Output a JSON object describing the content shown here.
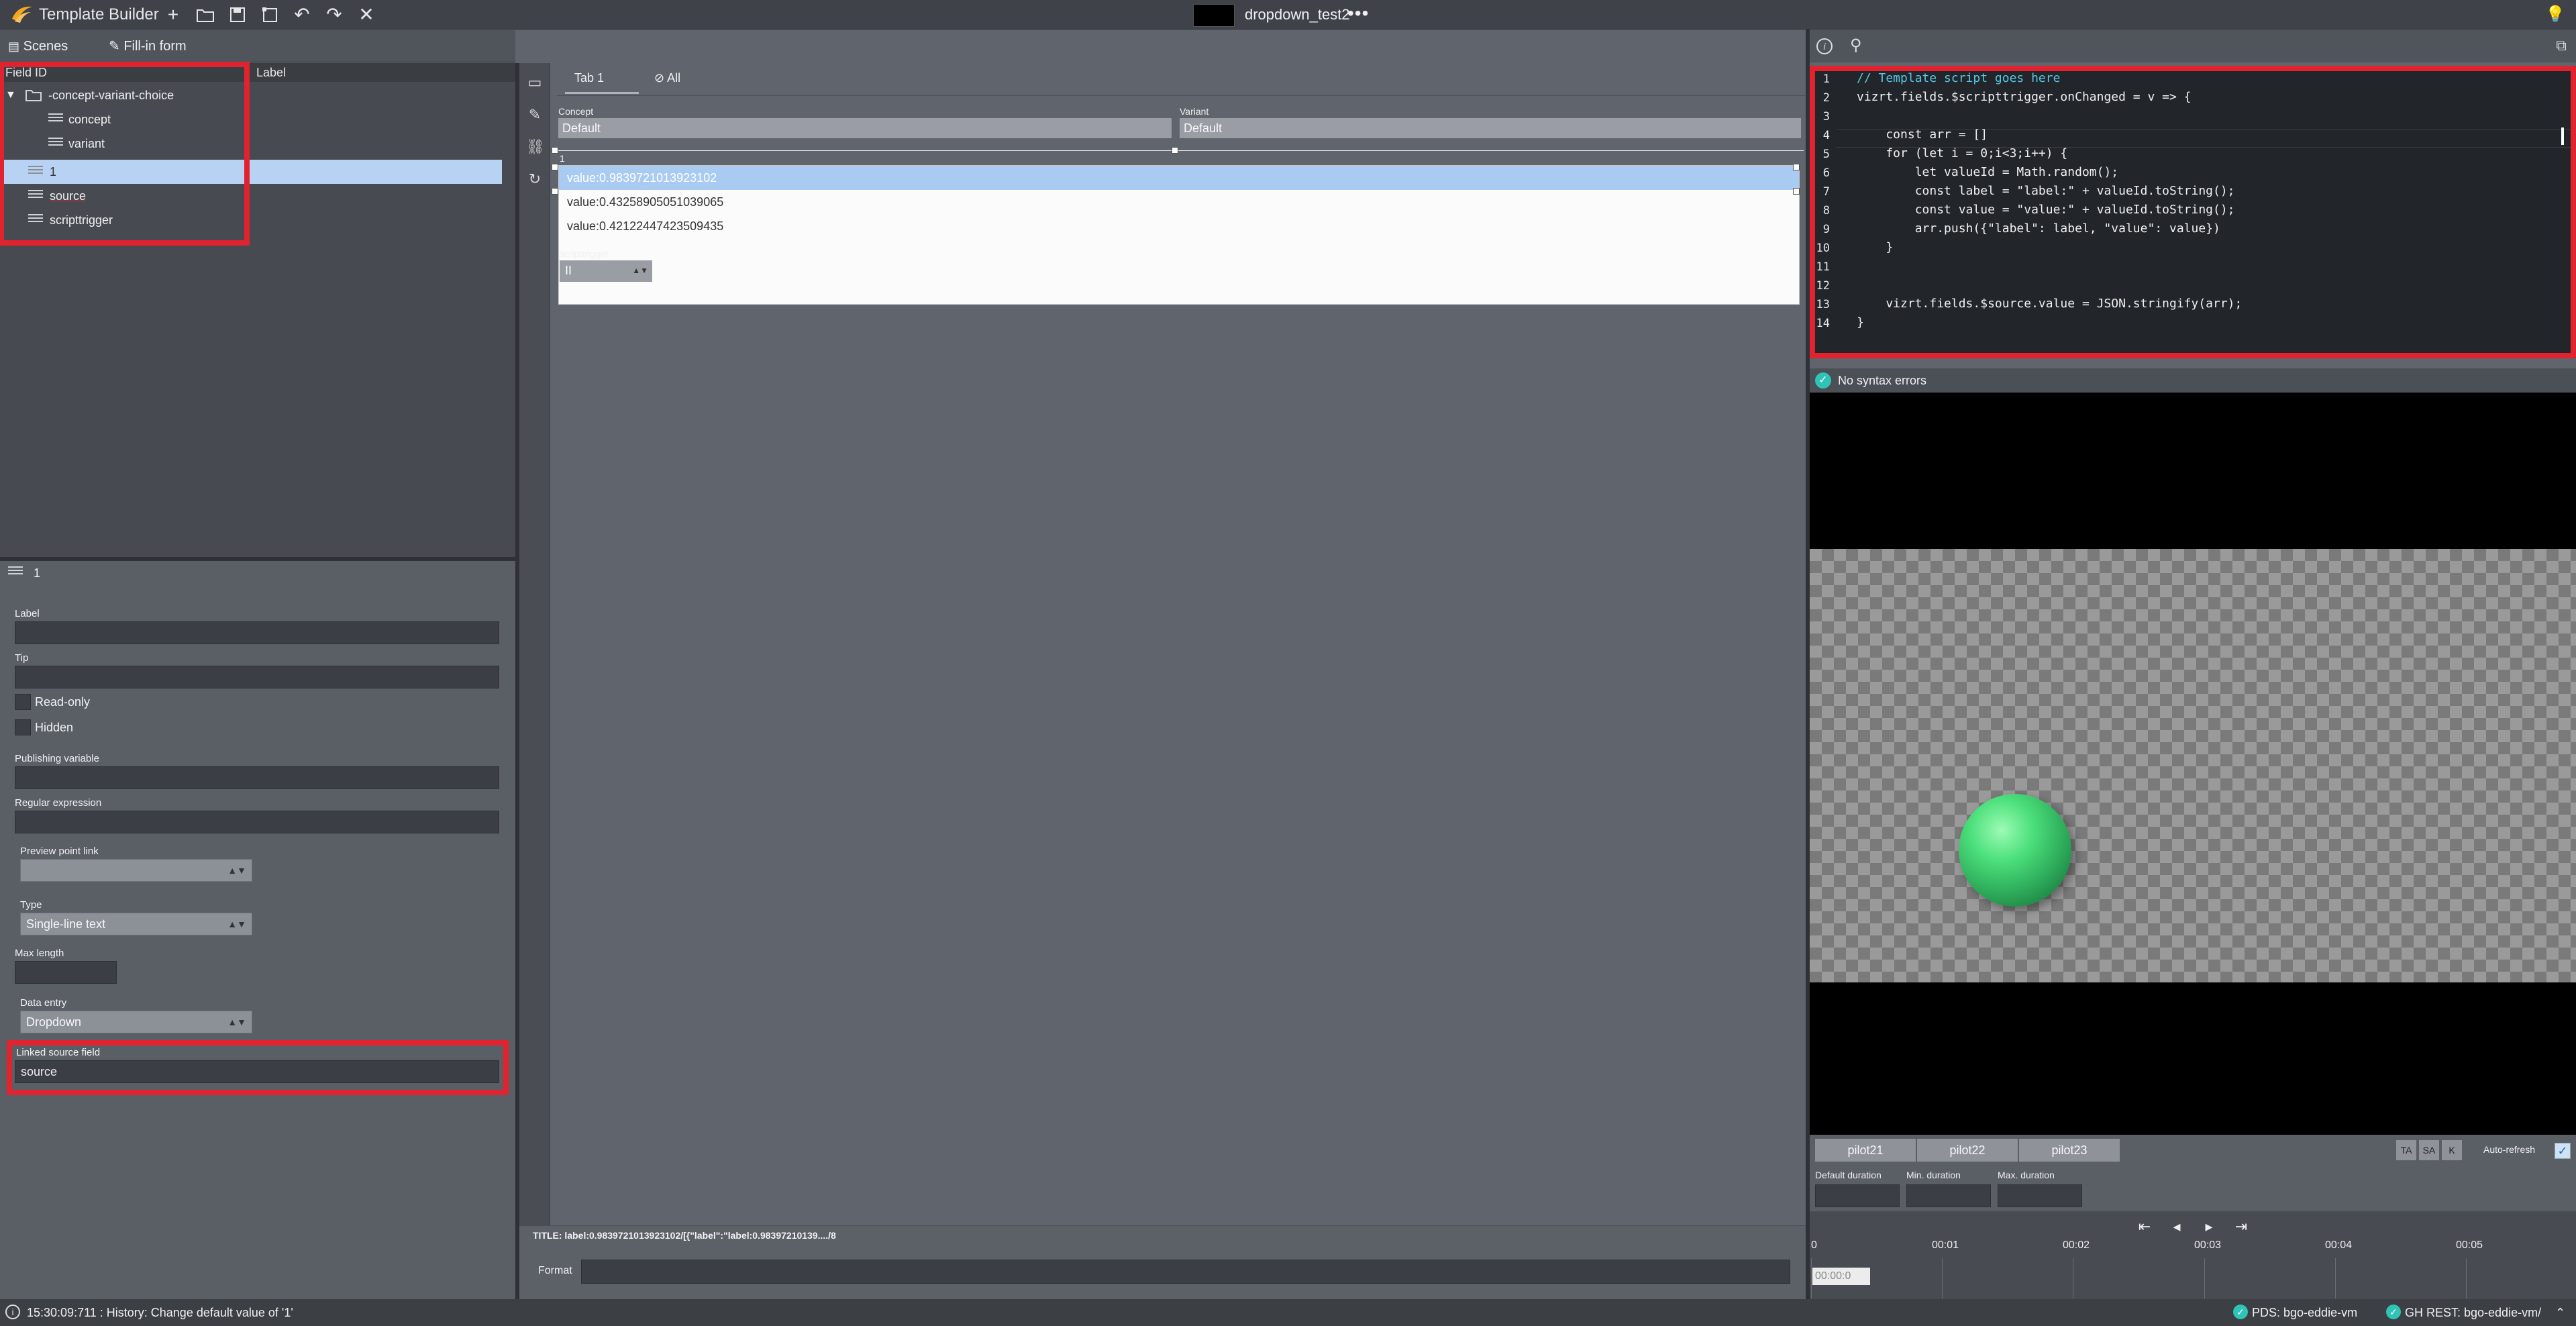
{
  "app": {
    "title": "Template Builder",
    "document": "dropdown_test2",
    "more": "•••"
  },
  "subbar": {
    "scenes": "Scenes",
    "fill_in_form": "Fill-in form"
  },
  "tree": {
    "headers": {
      "field_id": "Field ID",
      "label": "Label"
    },
    "items": [
      {
        "label": "-concept-variant-choice",
        "type": "folder"
      },
      {
        "label": "concept",
        "type": "field"
      },
      {
        "label": "variant",
        "type": "field"
      },
      {
        "label": "1",
        "type": "field",
        "selected": true
      },
      {
        "label": "source",
        "type": "field"
      },
      {
        "label": "scripttrigger",
        "type": "field"
      }
    ]
  },
  "props": {
    "heading": "1",
    "label_lbl": "Label",
    "label_val": "",
    "tip_lbl": "Tip",
    "tip_val": "",
    "readonly": "Read-only",
    "hidden": "Hidden",
    "pubvar_lbl": "Publishing variable",
    "regex_lbl": "Regular expression",
    "preview_lbl": "Preview point link",
    "preview_val": "",
    "type_lbl": "Type",
    "type_val": "Single-line text",
    "maxlen_lbl": "Max length",
    "dataentry_lbl": "Data entry",
    "dataentry_val": "Dropdown",
    "linked_lbl": "Linked source field",
    "linked_val": "source"
  },
  "middle": {
    "tabs": [
      "Tab 1",
      "All"
    ],
    "concept_lbl": "Concept",
    "concept_val": "Default",
    "variant_lbl": "Variant",
    "variant_val": "Default",
    "field_1_lbl": "1",
    "dropdown_options": [
      "value:0.9839721013923102",
      "value:0.43258905051039065",
      "value:0.42122447423509435"
    ],
    "selected_index": 0,
    "scripttrigger_lbl": "scripttrigger",
    "scripttrigger_val": "II",
    "title_line": "TITLE: label:0.9839721013923102/[{\"label\":\"label:0.98397210139..../8",
    "format_lbl": "Format"
  },
  "code": {
    "lines": [
      "// Template script goes here",
      "vizrt.fields.$scripttrigger.onChanged = v => {",
      "",
      "    const arr = []",
      "    for (let i = 0;i<3;i++) {",
      "        let valueId = Math.random();",
      "        const label = \"label:\" + valueId.toString();",
      "        const value = \"value:\" + valueId.toString();",
      "        arr.push({\"label\": label, \"value\": value})",
      "    }",
      "",
      "",
      "    vizrt.fields.$source.value = JSON.stringify(arr);",
      "}"
    ]
  },
  "syntax": {
    "status": "No syntax errors"
  },
  "pilots": [
    "pilot21",
    "pilot22",
    "pilot23"
  ],
  "modes": [
    "TA",
    "SA",
    "K"
  ],
  "auto_refresh": "Auto-refresh",
  "durations": {
    "default": "Default duration",
    "min": "Min. duration",
    "max": "Max. duration"
  },
  "timeline": {
    "ticks": [
      "0",
      "00:01",
      "00:02",
      "00:03",
      "00:04",
      "00:05"
    ],
    "current": "00:00:0"
  },
  "status": {
    "history": "15:30:09:711 : History: Change default value of '1'",
    "pds": "PDS: bgo-eddie-vm",
    "gh": "GH REST: bgo-eddie-vm/"
  },
  "colors": {
    "accent": "#2ec4b6",
    "highlight": "#e0232f",
    "selection": "#b7d2f2"
  }
}
